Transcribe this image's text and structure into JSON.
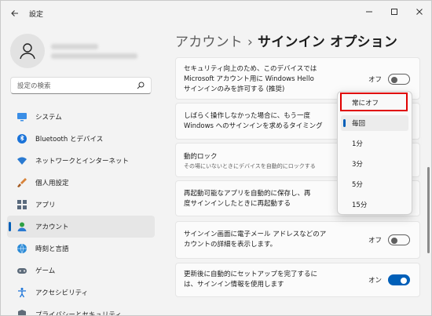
{
  "window": {
    "title": "設定",
    "controls": [
      "minimize",
      "maximize",
      "close"
    ]
  },
  "sidebar": {
    "search_placeholder": "設定の検索",
    "items": [
      {
        "label": "システム",
        "icon": "monitor-icon"
      },
      {
        "label": "Bluetooth とデバイス",
        "icon": "bluetooth-icon"
      },
      {
        "label": "ネットワークとインターネット",
        "icon": "network-icon"
      },
      {
        "label": "個人用設定",
        "icon": "brush-icon"
      },
      {
        "label": "アプリ",
        "icon": "apps-icon"
      },
      {
        "label": "アカウント",
        "icon": "account-icon",
        "active": true
      },
      {
        "label": "時刻と言語",
        "icon": "globe-clock-icon"
      },
      {
        "label": "ゲーム",
        "icon": "gamepad-icon"
      },
      {
        "label": "アクセシビリティ",
        "icon": "accessibility-icon"
      },
      {
        "label": "プライバシーとセキュリティ",
        "icon": "shield-icon"
      }
    ]
  },
  "header": {
    "breadcrumb_parent": "アカウント",
    "separator": "›",
    "title": "サインイン オプション"
  },
  "settings": {
    "hello": {
      "line1": "セキュリティ向上のため、このデバイスでは",
      "line2": "Microsoft アカウント用に Windows Hello",
      "line3": "サインインのみを許可する (推奨)",
      "state_label": "オフ",
      "on": false
    },
    "require_signin": {
      "line1": "しばらく操作しなかった場合に、もう一度",
      "line2": "Windows へのサインインを求めるタイミング"
    },
    "dynamic_lock": {
      "title": "動的ロック",
      "subtitle": "その場にいないときにデバイスを自動的にロックする"
    },
    "restart_apps": {
      "line1": "再起動可能なアプリを自動的に保存し、再",
      "line2": "度サインインしたときに再起動する"
    },
    "account_details": {
      "line1": "サインイン画面に電子メール アドレスなどのア",
      "line2": "カウントの詳細を表示します。",
      "state_label": "オフ",
      "on": false
    },
    "auto_setup": {
      "line1": "更新後に自動的にセットアップを完了するに",
      "line2": "は、サインイン情報を使用します",
      "state_label": "オン",
      "on": true
    }
  },
  "dropdown": {
    "options": [
      "常にオフ",
      "毎回",
      "1分",
      "3分",
      "5分",
      "15分"
    ],
    "selected": "毎回",
    "highlighted": "常にオフ"
  },
  "colors": {
    "accent": "#005fb8",
    "highlight_box": "#e00000"
  }
}
